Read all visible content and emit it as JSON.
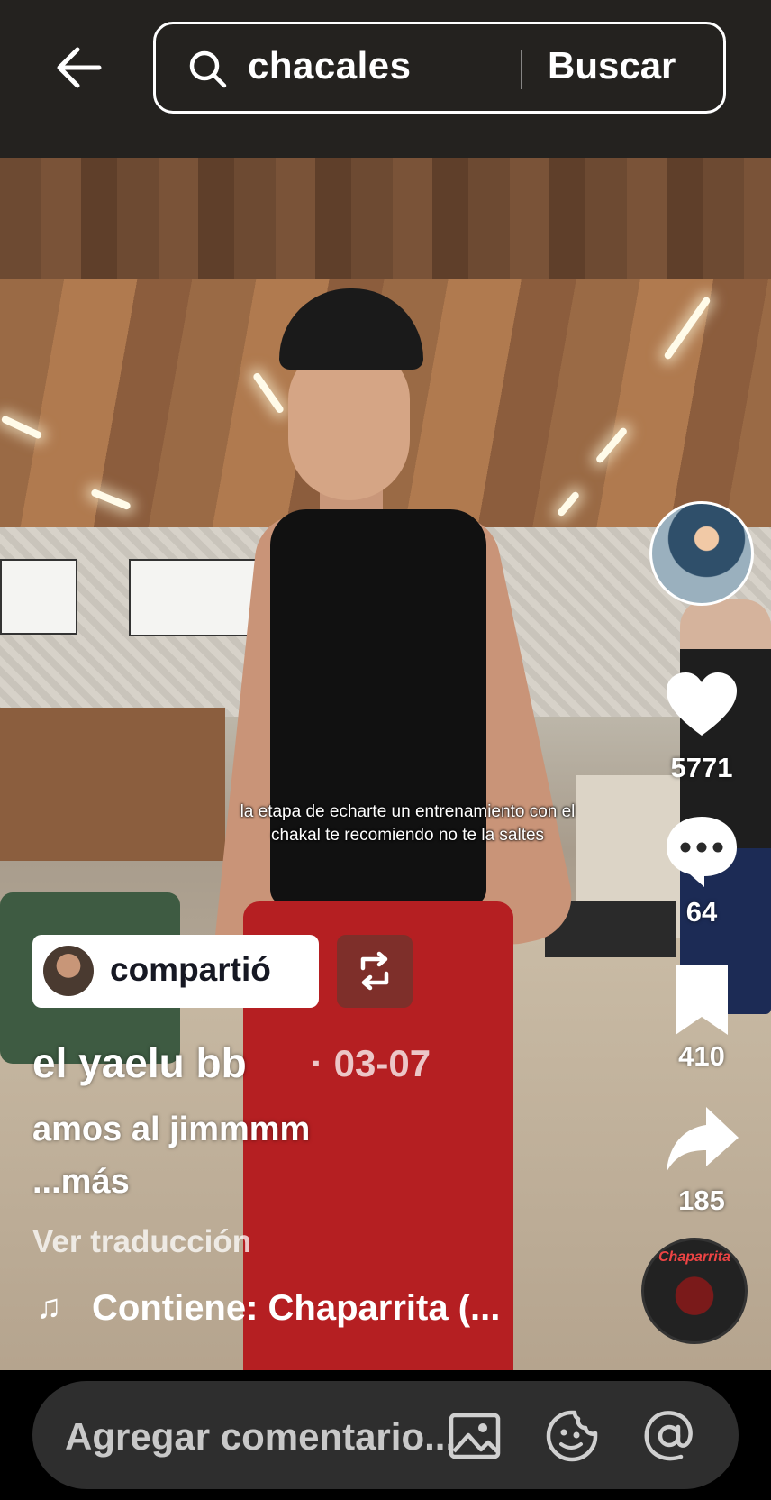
{
  "search": {
    "query": "chacales",
    "button_label": "Buscar"
  },
  "video": {
    "caption_overlay": "la etapa de echarte un entrenamiento con el chakal te recomiendo no te la saltes"
  },
  "actions": {
    "likes": "5771",
    "comments": "64",
    "saves": "410",
    "shares": "185"
  },
  "post": {
    "shared_label": "compartió",
    "username": "el yaelu bb",
    "date": "· 03-07",
    "description": "amos al jimmmm",
    "more_label": "...más",
    "translate_label": "Ver traducción",
    "music": "Contiene: Chaparrita (..."
  },
  "music_disc_text": "Chaparrita",
  "comment_bar": {
    "placeholder": "Agregar comentario..."
  },
  "colors": {
    "background": "#000000",
    "pill": "#ffffff",
    "comment_field": "#2e2e2e",
    "text": "#ffffff"
  },
  "icons": [
    "back-arrow-icon",
    "search-icon",
    "heart-icon",
    "comment-icon",
    "bookmark-icon",
    "share-icon",
    "repost-icon",
    "music-note-icon",
    "image-icon",
    "emoji-icon",
    "at-icon"
  ]
}
